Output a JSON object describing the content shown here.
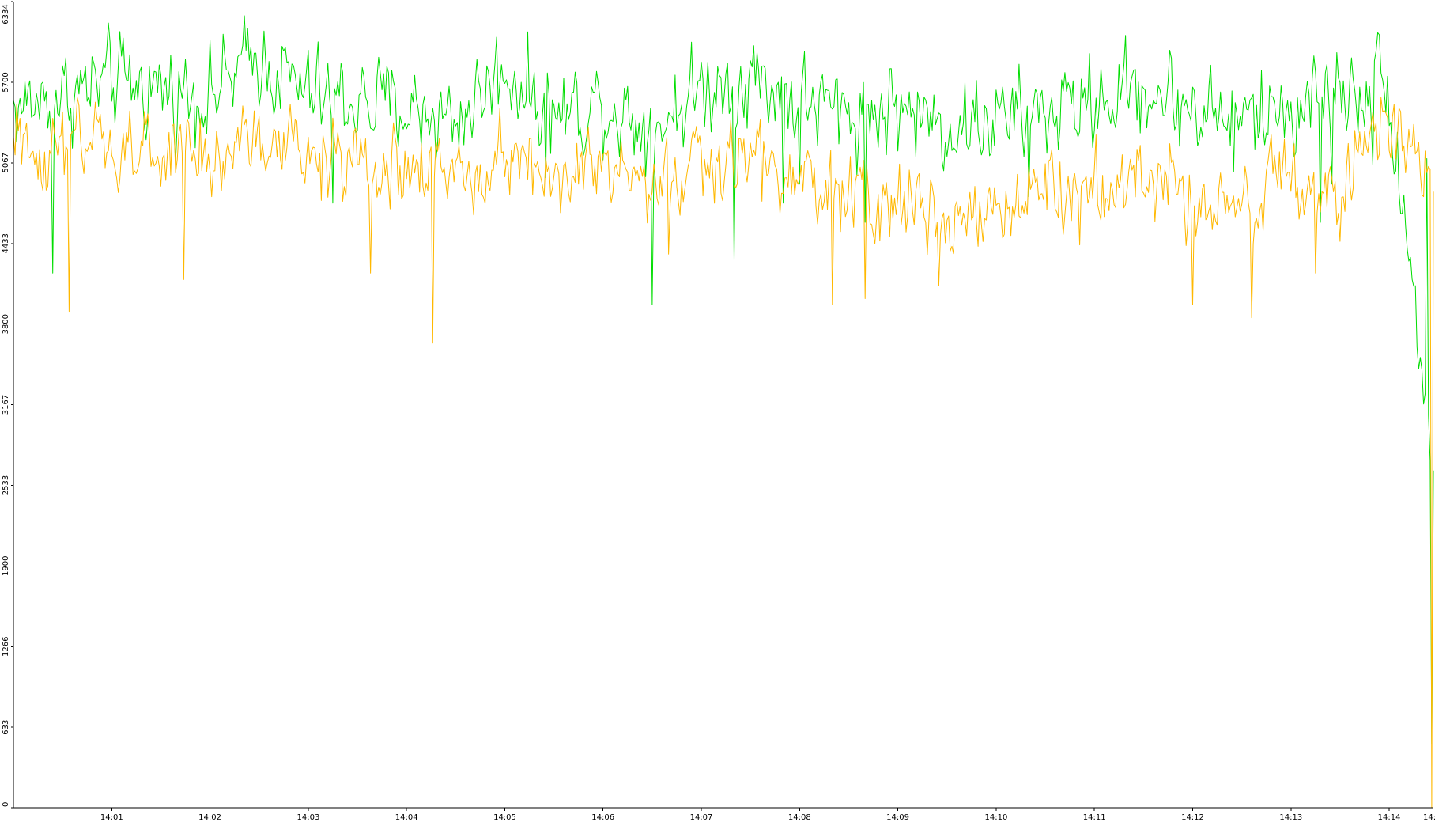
{
  "chart_data": {
    "type": "line",
    "title": "",
    "xlabel": "",
    "ylabel": "",
    "ylim": [
      0,
      6334
    ],
    "y_ticks": [
      0,
      633,
      1266,
      1900,
      2533,
      3167,
      3800,
      4433,
      5067,
      5700,
      6334
    ],
    "y_tick_labels": [
      "0",
      "633",
      "1266",
      "1900",
      "2533",
      "3167",
      "3800",
      "4433",
      "5067",
      "5700",
      "6334"
    ],
    "x_range_minutes": [
      0.0,
      14.45
    ],
    "x_ticks": [
      1,
      2,
      3,
      4,
      5,
      6,
      7,
      8,
      9,
      10,
      11,
      12,
      13,
      14
    ],
    "x_tick_labels": [
      "14:01",
      "14:02",
      "14:03",
      "14:04",
      "14:05",
      "14:06",
      "14:07",
      "14:08",
      "14:09",
      "14:10",
      "14:11",
      "14:12",
      "14:13",
      "14:14",
      "14:"
    ],
    "x_truncated_label": "14:",
    "grid": false,
    "legend": "none",
    "series": [
      {
        "color": "#00dd00",
        "x_step_seconds": 1,
        "level_anchors": [
          [
            0,
            5500
          ],
          [
            60,
            5700
          ],
          [
            120,
            5600
          ],
          [
            150,
            5900
          ],
          [
            180,
            5600
          ],
          [
            240,
            5500
          ],
          [
            270,
            5400
          ],
          [
            300,
            5800
          ],
          [
            330,
            5450
          ],
          [
            360,
            5550
          ],
          [
            390,
            5350
          ],
          [
            420,
            5650
          ],
          [
            450,
            5750
          ],
          [
            480,
            5550
          ],
          [
            510,
            5450
          ],
          [
            540,
            5500
          ],
          [
            570,
            5350
          ],
          [
            600,
            5400
          ],
          [
            630,
            5450
          ],
          [
            660,
            5550
          ],
          [
            690,
            5650
          ],
          [
            720,
            5500
          ],
          [
            750,
            5400
          ],
          [
            780,
            5500
          ],
          [
            810,
            5650
          ],
          [
            840,
            5700
          ],
          [
            867,
            2700
          ]
        ],
        "noise_amplitude": 260,
        "spikes": [
          [
            3,
            5500
          ],
          [
            13,
            5450
          ],
          [
            24,
            4200
          ],
          [
            195,
            4750
          ],
          [
            325,
            4950
          ],
          [
            390,
            3950
          ],
          [
            440,
            4300
          ],
          [
            470,
            4750
          ],
          [
            480,
            4900
          ],
          [
            520,
            4600
          ],
          [
            620,
            4800
          ],
          [
            745,
            5000
          ],
          [
            798,
            4600
          ],
          [
            805,
            4900
          ],
          [
            830,
            5050
          ],
          [
            863,
            5100
          ],
          [
            866,
            500
          ],
          [
            867,
            2650
          ]
        ]
      },
      {
        "color": "#ffb800",
        "x_step_seconds": 1,
        "level_anchors": [
          [
            0,
            5200
          ],
          [
            60,
            5150
          ],
          [
            120,
            5100
          ],
          [
            150,
            5250
          ],
          [
            180,
            5100
          ],
          [
            240,
            5000
          ],
          [
            270,
            4950
          ],
          [
            300,
            5200
          ],
          [
            330,
            4950
          ],
          [
            360,
            5000
          ],
          [
            390,
            4850
          ],
          [
            420,
            5050
          ],
          [
            450,
            5100
          ],
          [
            480,
            4900
          ],
          [
            510,
            4800
          ],
          [
            540,
            4750
          ],
          [
            570,
            4650
          ],
          [
            600,
            4700
          ],
          [
            630,
            4800
          ],
          [
            660,
            4850
          ],
          [
            690,
            4950
          ],
          [
            720,
            4850
          ],
          [
            750,
            4750
          ],
          [
            780,
            4900
          ],
          [
            810,
            4800
          ],
          [
            840,
            5350
          ],
          [
            867,
            5050
          ]
        ],
        "noise_amplitude": 240,
        "spikes": [
          [
            34,
            3900
          ],
          [
            104,
            4150
          ],
          [
            218,
            4200
          ],
          [
            256,
            3650
          ],
          [
            400,
            4350
          ],
          [
            500,
            3950
          ],
          [
            520,
            4000
          ],
          [
            565,
            4100
          ],
          [
            720,
            3950
          ],
          [
            756,
            3850
          ],
          [
            795,
            4200
          ],
          [
            810,
            4450
          ],
          [
            866,
            0
          ]
        ]
      }
    ]
  }
}
